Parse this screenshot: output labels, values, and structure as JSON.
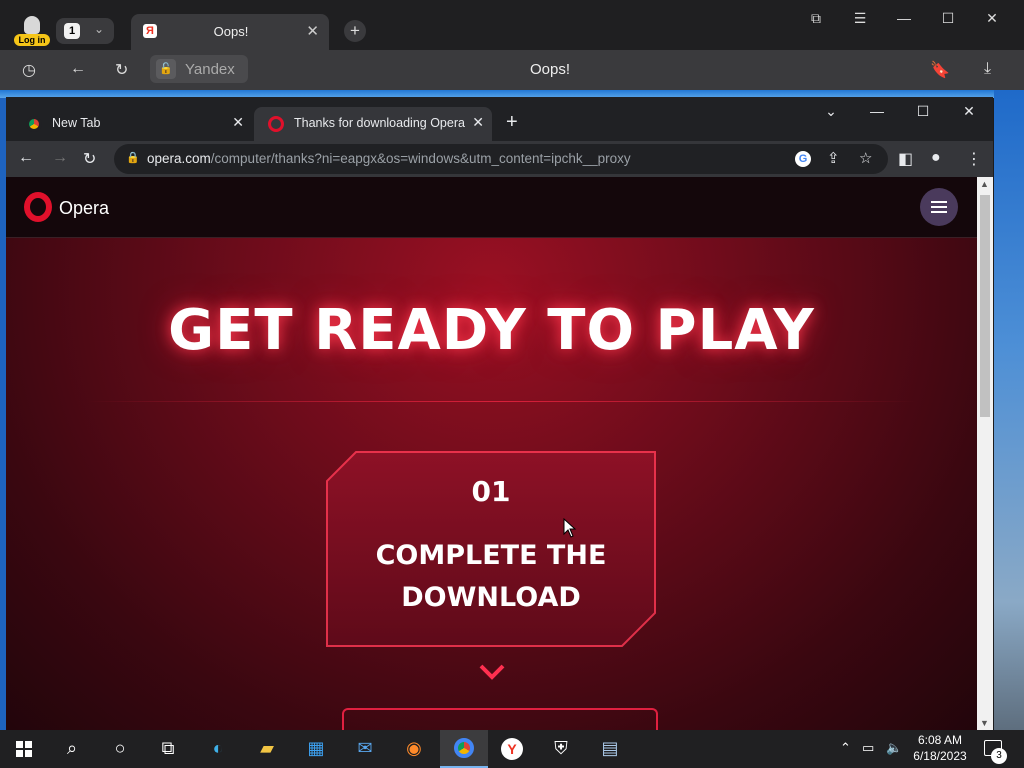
{
  "yandex": {
    "login_label": "Log in",
    "tab_count": "1",
    "tab_title": "Oops!",
    "address_site": "Yandex",
    "page_title": "Oops!"
  },
  "chrome": {
    "tabs": [
      {
        "title": "New Tab"
      },
      {
        "title": "Thanks for downloading Opera"
      }
    ],
    "url_host": "opera.com",
    "url_path": "/computer/thanks?ni=eapgx&os=windows&utm_content=ipchk__proxy"
  },
  "page": {
    "logo_text": "Opera",
    "hero_title": "GET READY TO PLAY",
    "step_number": "01",
    "step_text": "COMPLETE THE DOWNLOAD"
  },
  "taskbar": {
    "time": "6:08 AM",
    "date": "6/18/2023",
    "notification_count": "3",
    "apps": [
      "start",
      "search",
      "cortana",
      "task-view",
      "edge",
      "file-explorer",
      "store",
      "mail",
      "firefox",
      "chrome",
      "yandex",
      "security",
      "network-app"
    ]
  },
  "colors": {
    "opera_red": "#e0102b",
    "hero_red": "#8e1126",
    "chrome_dark": "#202124"
  }
}
